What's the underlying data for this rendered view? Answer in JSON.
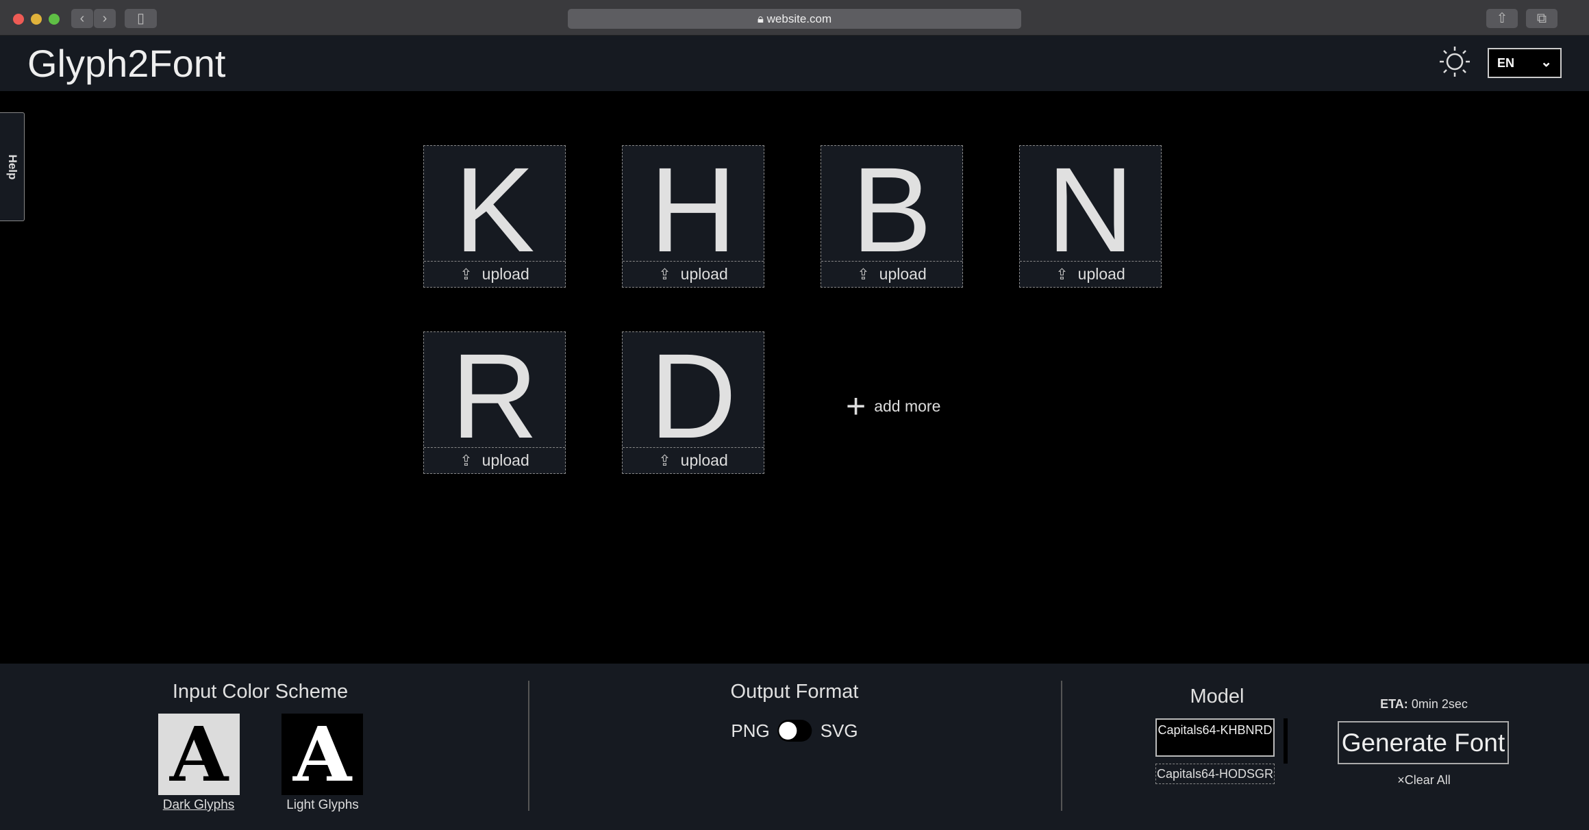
{
  "browser": {
    "url": "website.com"
  },
  "header": {
    "title": "Glyph2Font",
    "language": "EN"
  },
  "help": {
    "label": "Help"
  },
  "glyphs": [
    {
      "char": "K",
      "upload_label": "upload"
    },
    {
      "char": "H",
      "upload_label": "upload"
    },
    {
      "char": "B",
      "upload_label": "upload"
    },
    {
      "char": "N",
      "upload_label": "upload"
    },
    {
      "char": "R",
      "upload_label": "upload"
    },
    {
      "char": "D",
      "upload_label": "upload"
    }
  ],
  "add_more": {
    "label": "add more"
  },
  "color_scheme": {
    "title": "Input Color Scheme",
    "options": [
      {
        "sample": "A",
        "label": "Dark Glyphs",
        "selected": true
      },
      {
        "sample": "A",
        "label": "Light Glyphs",
        "selected": false
      }
    ]
  },
  "output_format": {
    "title": "Output Format",
    "left": "PNG",
    "right": "SVG",
    "selected": "PNG"
  },
  "model": {
    "title": "Model",
    "selected": "Capitals64-KHBNRD",
    "options": [
      "Capitals64-KHBNRD",
      "Capitals64-HODSGR"
    ]
  },
  "eta": {
    "label": "ETA:",
    "value": "0min 2sec"
  },
  "generate": {
    "label": "Generate Font"
  },
  "clear": {
    "icon": "×",
    "label": "Clear All"
  }
}
